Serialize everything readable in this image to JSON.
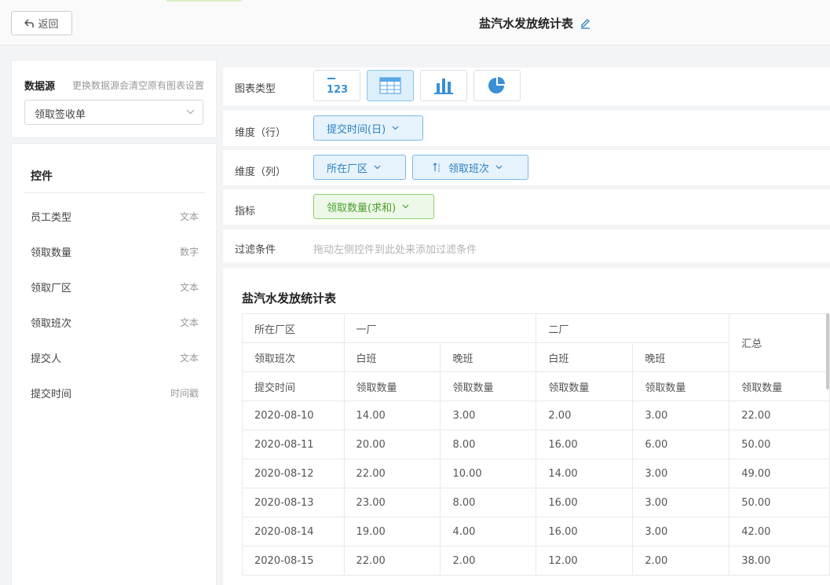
{
  "header": {
    "back_label": "返回",
    "title": "盐汽水发放统计表"
  },
  "datasource": {
    "label": "数据源",
    "hint": "更换数据源会清空原有图表设置",
    "selected": "领取签收单"
  },
  "controls": {
    "title": "控件",
    "items": [
      {
        "name": "员工类型",
        "type": "文本"
      },
      {
        "name": "领取数量",
        "type": "数字"
      },
      {
        "name": "领取厂区",
        "type": "文本"
      },
      {
        "name": "领取班次",
        "type": "文本"
      },
      {
        "name": "提交人",
        "type": "文本"
      },
      {
        "name": "提交时间",
        "type": "时间戳"
      }
    ]
  },
  "config": {
    "chart_type_label": "图表类型",
    "chart_types": [
      "number-card",
      "table",
      "bar-chart",
      "pie-chart"
    ],
    "active_chart_type": "table",
    "row_dim_label": "维度（行）",
    "row_dim": "提交时间(日)",
    "col_dim_label": "维度（列）",
    "col_dims": [
      "所在厂区",
      "领取班次"
    ],
    "metric_label": "指标",
    "metric": "领取数量(求和)",
    "filter_label": "过滤条件",
    "filter_hint": "拖动左侧控件到此处来添加过滤条件"
  },
  "preview": {
    "title": "盐汽水发放统计表",
    "header": {
      "dim1_label": "所在厂区",
      "dim2_label": "领取班次",
      "dim3_label": "提交时间",
      "factories": [
        "一厂",
        "二厂"
      ],
      "shifts": [
        "白班",
        "晚班",
        "白班",
        "晚班"
      ],
      "total_label": "汇总",
      "metric_label": "领取数量"
    },
    "rows": [
      {
        "date": "2020-08-10",
        "values": [
          "14.00",
          "3.00",
          "2.00",
          "3.00",
          "22.00"
        ]
      },
      {
        "date": "2020-08-11",
        "values": [
          "20.00",
          "8.00",
          "16.00",
          "6.00",
          "50.00"
        ]
      },
      {
        "date": "2020-08-12",
        "values": [
          "22.00",
          "10.00",
          "14.00",
          "3.00",
          "49.00"
        ]
      },
      {
        "date": "2020-08-13",
        "values": [
          "23.00",
          "8.00",
          "16.00",
          "3.00",
          "50.00"
        ]
      },
      {
        "date": "2020-08-14",
        "values": [
          "19.00",
          "4.00",
          "16.00",
          "3.00",
          "42.00"
        ]
      },
      {
        "date": "2020-08-15",
        "values": [
          "22.00",
          "2.00",
          "12.00",
          "2.00",
          "38.00"
        ]
      }
    ]
  },
  "colors": {
    "accent_blue": "#2d7fc1",
    "accent_green": "#49a02b",
    "active_type_bg": "#dceffb"
  }
}
